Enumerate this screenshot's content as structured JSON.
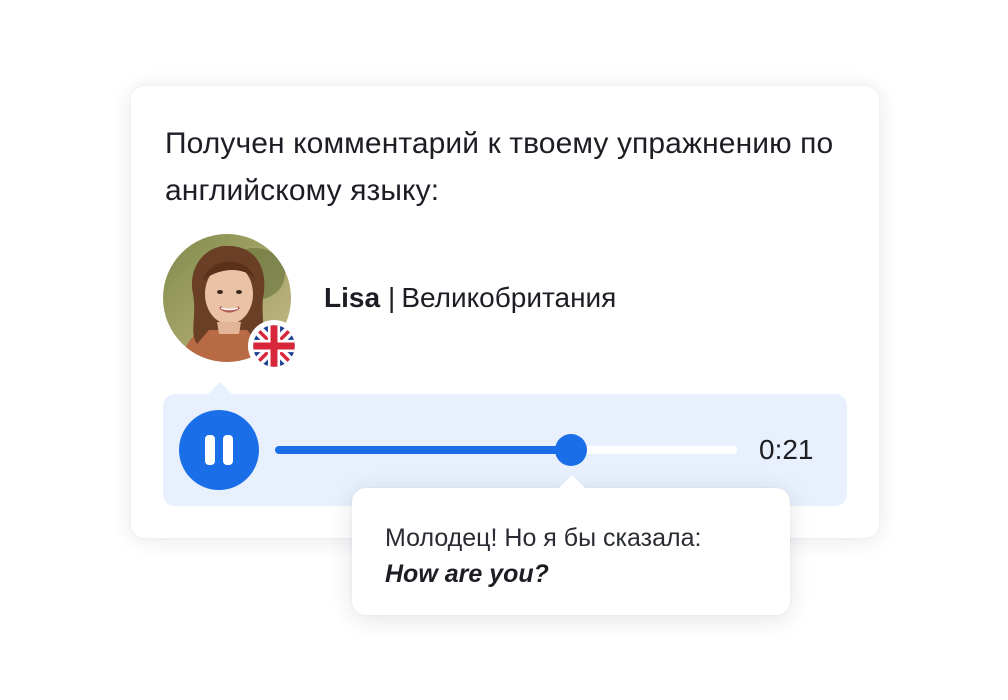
{
  "notification": {
    "heading": "Получен комментарий к твоему упражнению по английскому языку:"
  },
  "author": {
    "name": "Lisa",
    "separator": "|",
    "country": "Великобритания",
    "avatar_icon": "user-photo-avatar",
    "flag_icon": "uk-flag-icon"
  },
  "player": {
    "state_icon": "pause-icon",
    "progress_fraction": 0.64,
    "time": "0:21"
  },
  "comment": {
    "text": "Молодец! Но я бы сказала:",
    "phrase": "How are you?"
  },
  "colors": {
    "accent": "#1a6fe8",
    "player_bg": "#e8f0fd",
    "text": "#1c1e24"
  }
}
